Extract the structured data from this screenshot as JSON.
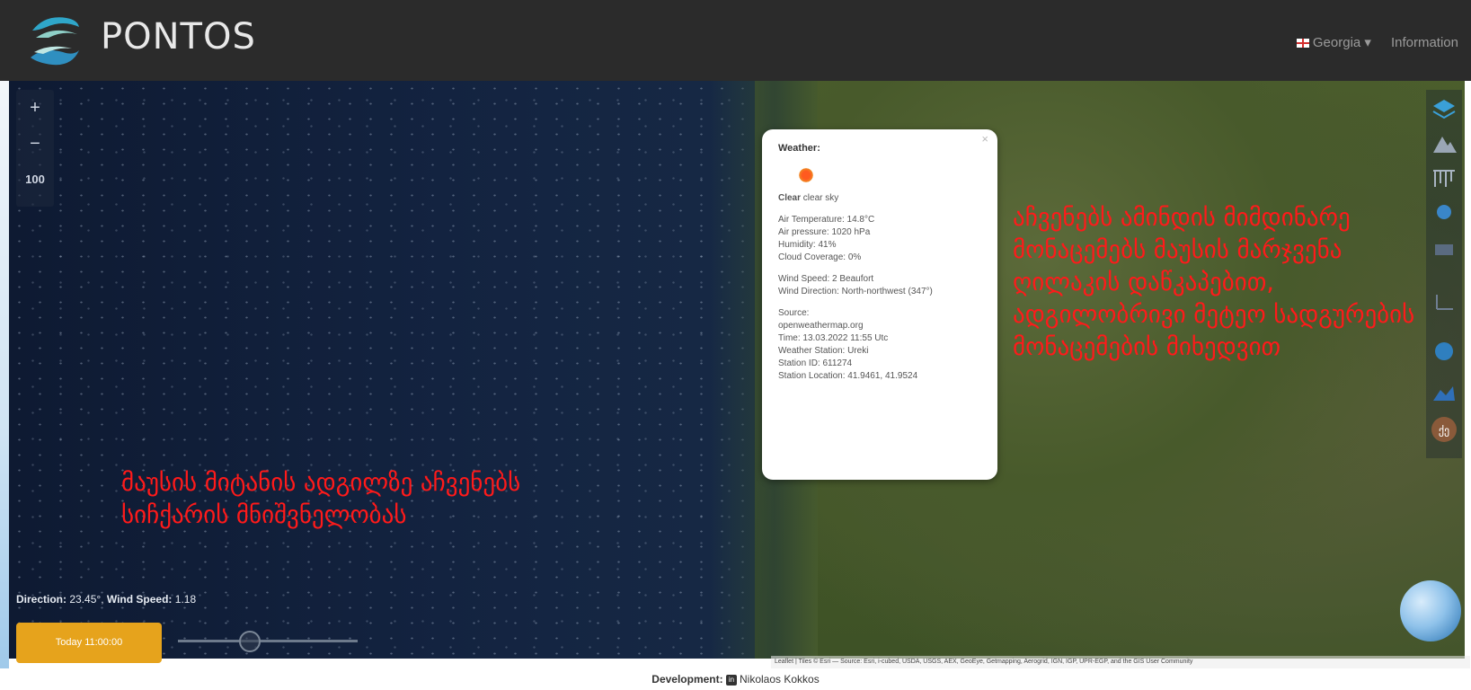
{
  "header": {
    "brand": "PONTOS",
    "country_label": "Georgia",
    "country_flag": "georgia-flag-icon",
    "information_label": "Information"
  },
  "map_controls": {
    "zoom_in": "+",
    "zoom_out": "−",
    "zoom_level": "100"
  },
  "popup": {
    "title": "Weather:",
    "icon": "sun-icon",
    "condition_main": "Clear",
    "condition_desc": "clear sky",
    "air_temperature": "Air Temperature: 14.8°C",
    "air_pressure": "Air pressure: 1020 hPa",
    "humidity": "Humidity: 41%",
    "cloud_coverage": "Cloud Coverage: 0%",
    "wind_speed": "Wind Speed: 2 Beaufort",
    "wind_direction": "Wind Direction: North-northwest (347°)",
    "source_label": "Source:",
    "source_value": "openweathermap.org",
    "time": "Time: 13.03.2022 11:55 Utc",
    "station_name": "Weather Station: Ureki",
    "station_id": "Station ID: 611274",
    "station_location": "Station Location: 41.9461, 41.9524"
  },
  "annotations": {
    "right": "აჩვენებს ამინდის მიმდინარე მონაცემებს მაუსის მარჯვენა ღილაკის დაწკაპებით, ადგილობრივი მეტეო სადგურების მონაცემების მიხედვით",
    "left": "მაუსის მიტანის ადგილზე აჩვენებს სიჩქარის მნიშვნელობას"
  },
  "readout": {
    "direction_label": "Direction:",
    "direction_value": "23.45°,",
    "wind_speed_label": "Wind Speed:",
    "wind_speed_value": "1.18"
  },
  "time_button": {
    "label": "Today 11:00:00"
  },
  "time_slider": {
    "position_fraction": 0.4
  },
  "attribution": "Leaflet | Tiles © Esri — Source: Esri, i-cubed, USDA, USGS, AEX, GeoEye, Getmapping, Aerogrid, IGN, IGP, UPR-EGP, and the GIS User Community",
  "footer": {
    "label": "Development:",
    "icon": "linkedin-icon",
    "name": "Nikolaos Kokkos"
  },
  "right_toolbar_icons": [
    "layers-icon",
    "mountain-icon",
    "waves-icon",
    "ocean-layer-icon",
    "chart-icon",
    "current-icon",
    "globe-layer-icon",
    "area-icon",
    "georgian-language-icon"
  ],
  "colors": {
    "navbar": "#2b2b2b",
    "annotation": "#ff1a1a",
    "time_button": "#e6a31c"
  }
}
